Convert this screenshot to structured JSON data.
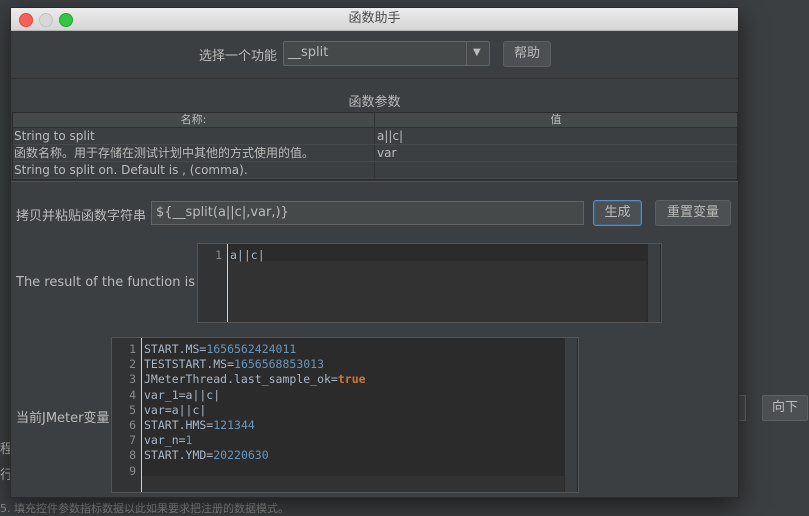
{
  "background": {
    "down_button": "向下",
    "left_text_1": "程",
    "left_text_2": "行",
    "bottom_text": "5. 填充控件参数指标数据以此如果要求把注册的数据模式。"
  },
  "dialog": {
    "title": "函数助手",
    "select_label": "选择一个功能",
    "selected_function": "__split",
    "help_button": "帮助",
    "params_title": "函数参数",
    "table": {
      "col_name": "名称:",
      "col_value": "值",
      "rows": [
        {
          "name": "String to split",
          "value": "a||c|"
        },
        {
          "name": "函数名称。用于存储在测试计划中其他的方式使用的值。",
          "value": "var"
        },
        {
          "name": "String to split on. Default is , (comma).",
          "value": ""
        }
      ]
    },
    "copy_label": "拷贝并粘贴函数字符串",
    "function_string": "${__split(a||c|,var,)}",
    "generate_button": "生成",
    "reset_button": "重置变量",
    "result_label": "The result of the function is",
    "result_lines": [
      {
        "num": "1",
        "text": "a||c|"
      }
    ],
    "vars_label": "当前JMeter变量",
    "vars_lines": [
      {
        "num": "1",
        "key": "START.MS=",
        "val": "1656562424011",
        "kind": "num"
      },
      {
        "num": "2",
        "key": "TESTSTART.MS=",
        "val": "1656568853013",
        "kind": "num"
      },
      {
        "num": "3",
        "key": "JMeterThread.last_sample_ok=",
        "val": "true",
        "kind": "bool"
      },
      {
        "num": "4",
        "key": "var_1=a||c|",
        "val": "",
        "kind": "text"
      },
      {
        "num": "5",
        "key": "var=a||c|",
        "val": "",
        "kind": "text"
      },
      {
        "num": "6",
        "key": "START.HMS=",
        "val": "121344",
        "kind": "num"
      },
      {
        "num": "7",
        "key": "var_n=",
        "val": "1",
        "kind": "num"
      },
      {
        "num": "8",
        "key": "START.YMD=",
        "val": "20220630",
        "kind": "num"
      },
      {
        "num": "9",
        "key": "",
        "val": "",
        "kind": "text"
      }
    ]
  },
  "colors": {
    "background": "#3c3f41",
    "editor_bg": "#2b2b2b",
    "number_value": "#6897bb",
    "keyword": "#cc7832",
    "close_dot": "#fc5f57",
    "max_dot": "#2fc840"
  }
}
